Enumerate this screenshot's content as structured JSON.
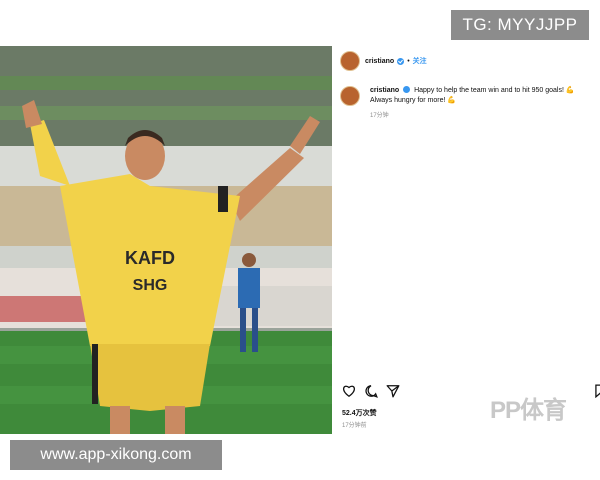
{
  "overlay": {
    "telegram_tag": "TG: MYYJJPP",
    "url": "www.app-xikong.com",
    "watermark_logo": "PP体育"
  },
  "post": {
    "username": "cristiano",
    "follow_label": "关注",
    "comment_text": "Happy to help the team win and to hit 950 goals! 💪 Always hungry for more! 💪",
    "comment_time": "17分钟",
    "likes": "52.4万次赞",
    "post_time": "17分钟前"
  },
  "photo": {
    "jersey_sponsor_top": "KAFD",
    "jersey_sponsor_bottom": "SHG",
    "colors": {
      "jersey": "#f2d24a",
      "pitch": "#3f8a3a",
      "stands": "#cfd2cc"
    }
  },
  "icons": [
    "heart-icon",
    "comment-icon",
    "share-icon",
    "bookmark-icon",
    "verified-icon"
  ]
}
